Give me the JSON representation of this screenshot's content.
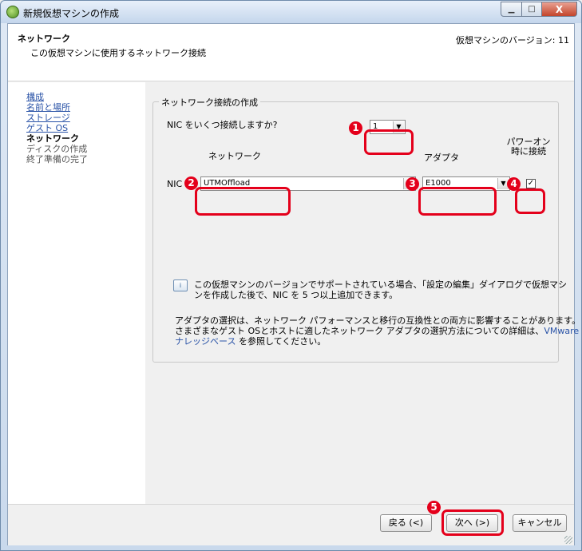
{
  "window": {
    "title": "新規仮想マシンの作成",
    "close_glyph": "X"
  },
  "header": {
    "title": "ネットワーク",
    "subtitle": "この仮想マシンに使用するネットワーク接続",
    "version": "仮想マシンのバージョン: 11"
  },
  "nav": {
    "items": [
      {
        "label": "構成",
        "state": "link"
      },
      {
        "label": "名前と場所",
        "state": "link"
      },
      {
        "label": "ストレージ",
        "state": "link"
      },
      {
        "label": "ゲスト OS",
        "state": "link"
      },
      {
        "label": "ネットワーク",
        "state": "current"
      },
      {
        "label": "ディスクの作成",
        "state": "disabled"
      },
      {
        "label": "終了準備の完了",
        "state": "disabled"
      }
    ]
  },
  "network": {
    "group_title": "ネットワーク接続の作成",
    "nic_question": "NIC をいくつ接続しますか?",
    "nic_count": "1",
    "col_network": "ネットワーク",
    "col_adapter": "アダプタ",
    "col_power_line1": "パワーオン",
    "col_power_line2": "時に接続",
    "nic1_label": "NIC 1:",
    "nic1_network": "UTMOffload",
    "nic1_adapter": "E1000",
    "nic1_connect_glyph": "✓",
    "info_line1": "この仮想マシンのバージョンでサポートされている場合、「設定の編集」ダイアログで仮想マシ",
    "info_line2": "ンを作成した後で、NIC を 5 つ以上追加できます。",
    "note_line1": "アダプタの選択は、ネットワーク パフォーマンスと移行の互換性との両方に影響することがあります。",
    "note_line2_pre": "さまざまなゲスト OSとホストに適したネットワーク アダプタの選択方法についての詳細は、",
    "note_link_a": "VMware",
    "note_link_b": "ナレッジベース",
    "note_line3_post": " を参照してください。"
  },
  "callouts": {
    "c1": "1",
    "c2": "2",
    "c3": "3",
    "c4": "4",
    "c5": "5"
  },
  "footer": {
    "back": "戻る (<)",
    "next": "次へ (>)",
    "cancel": "キャンセル"
  },
  "colors": {
    "accent_red": "#e4001b",
    "link_blue": "#2a53a7"
  }
}
